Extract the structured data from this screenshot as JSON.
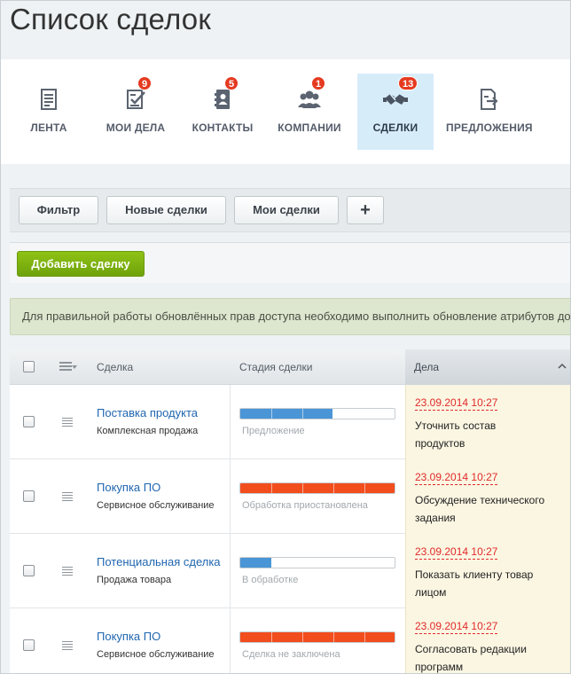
{
  "page": {
    "title": "Список сделок"
  },
  "nav": {
    "items": [
      {
        "label": "ЛЕНТА",
        "badge": "",
        "active": false,
        "icon": "feed-icon"
      },
      {
        "label": "МОИ ДЕЛА",
        "badge": "9",
        "active": false,
        "icon": "tasks-icon"
      },
      {
        "label": "КОНТАКТЫ",
        "badge": "5",
        "active": false,
        "icon": "contacts-icon"
      },
      {
        "label": "КОМПАНИИ",
        "badge": "1",
        "active": false,
        "icon": "companies-icon"
      },
      {
        "label": "СДЕЛКИ",
        "badge": "13",
        "active": true,
        "icon": "handshake-icon"
      },
      {
        "label": "ПРЕДЛОЖЕНИЯ",
        "badge": "",
        "active": false,
        "icon": "quotes-icon"
      }
    ]
  },
  "filters": {
    "filter_label": "Фильтр",
    "new_deals_label": "Новые сделки",
    "my_deals_label": "Мои сделки",
    "add_filter_label": "+"
  },
  "toolbar": {
    "add_deal_label": "Добавить сделку"
  },
  "notice": {
    "text": "Для правильной работы обновлённых прав доступа необходимо выполнить обновление атрибутов доступа"
  },
  "grid": {
    "columns": {
      "deal": "Сделка",
      "stage": "Стадия сделки",
      "tasks": "Дела"
    },
    "rows": [
      {
        "title": "Поставка продукта",
        "type": "Комплексная продажа",
        "stage": "Предложение",
        "progress": 0.6,
        "status": "progress",
        "task_date": "23.09.2014 10:27",
        "task_title": "Уточнить состав продуктов"
      },
      {
        "title": "Покупка ПО",
        "type": "Сервисное обслуживание",
        "stage": "Обработка приостановлена",
        "progress": 1.0,
        "status": "failed",
        "task_date": "23.09.2014 10:27",
        "task_title": "Обсуждение технического задания"
      },
      {
        "title": "Потенциальная сделка",
        "type": "Продажа товара",
        "stage": "В обработке",
        "progress": 0.2,
        "status": "progress",
        "task_date": "23.09.2014 10:27",
        "task_title": "Показать клиенту товар лицом"
      },
      {
        "title": "Покупка ПО",
        "type": "Сервисное обслуживание",
        "stage": "Сделка не заключена",
        "progress": 1.0,
        "status": "failed",
        "task_date": "23.09.2014 10:27",
        "task_title": "Согласовать редакции программ"
      }
    ]
  },
  "colors": {
    "progress": "#4a95d6",
    "failed": "#f24d1d",
    "accent_green": "#7cb30f",
    "badge": "#e53a20"
  }
}
